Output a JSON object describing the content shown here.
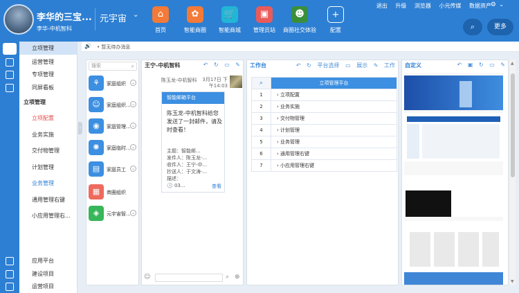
{
  "header": {
    "user_name": "李华的三宝...",
    "user_org": "李华-中机智科",
    "app_name": "元宇宙",
    "nav": [
      {
        "label": "首页",
        "icon": "home-icon",
        "color": "#f47a37"
      },
      {
        "label": "智能商圈",
        "icon": "flower-icon",
        "color": "#f47a37"
      },
      {
        "label": "智能商城",
        "icon": "cart-icon",
        "color": "#21b6d6"
      },
      {
        "label": "管理员站",
        "icon": "admin-icon",
        "color": "#e95b5b"
      },
      {
        "label": "商圈社交体验",
        "icon": "people-icon",
        "color": "#3a8f3a"
      },
      {
        "label": "配置",
        "icon": "plus-icon",
        "color": "#2d7fd3"
      }
    ],
    "top_links": [
      "退出",
      "升级",
      "浏览器",
      "小元传媒",
      "数据资产"
    ],
    "more_label": "更多"
  },
  "sidebar": {
    "top_items": [
      "立项管理",
      "运营管理",
      "专项管理",
      "同屏看板"
    ],
    "section_title": "立项管理",
    "sub_items": [
      "立项配置",
      "业务实施",
      "交付物管理",
      "计划管理",
      "业务管理",
      "通用管理右键",
      "小应用管理右..."
    ],
    "bottom_items": [
      "应用平台",
      "建设项目",
      "运营项目"
    ]
  },
  "notice": {
    "text": "• 暂无待办消息"
  },
  "contacts": {
    "search_placeholder": "搜索",
    "items": [
      {
        "name": "家庭组织",
        "icon": "group-icon",
        "color": "#3c8fe1"
      },
      {
        "name": "家庭组织...",
        "icon": "person-icon",
        "color": "#3c8fe1"
      },
      {
        "name": "家庭管理...",
        "icon": "camera-icon",
        "color": "#3c8fe1"
      },
      {
        "name": "家庭临时...",
        "icon": "gear-icon",
        "color": "#3c8fe1"
      },
      {
        "name": "家庭员工",
        "icon": "id-card-icon",
        "color": "#3c8fe1"
      },
      {
        "name": "商圈组织",
        "icon": "grid-icon",
        "color": "#ee6a5c"
      },
      {
        "name": "元宇宙智...",
        "icon": "layers-icon",
        "color": "#38b65a"
      }
    ]
  },
  "chat": {
    "title": "王宁-中机智科",
    "sender": "陈玉龙-中机智科",
    "date": "3月17日 下午14:03",
    "card_title": "智能邮箱平台",
    "card_message": "陈玉龙-中机智科给您发送了一封邮件，请及时查看！",
    "card_lines": [
      "主题：智能邮...",
      "发件人：陈玉龙-...",
      "收件人：王宁-中...",
      "抄送人：于文涛-...",
      "描述：",
      "🕓 03..."
    ],
    "card_link": "查看"
  },
  "workbench": {
    "title": "工作台",
    "tools": [
      "平台选择",
      "展示",
      "工作"
    ],
    "table_title": "立项管理平台",
    "rows": [
      {
        "num": "1",
        "label": "立项配置"
      },
      {
        "num": "2",
        "label": "业务实施"
      },
      {
        "num": "3",
        "label": "交付物管理"
      },
      {
        "num": "4",
        "label": "计划管理"
      },
      {
        "num": "5",
        "label": "业务管理"
      },
      {
        "num": "6",
        "label": "通用管理右键"
      },
      {
        "num": "7",
        "label": "小应用管理右键"
      }
    ]
  },
  "custom": {
    "title": "自定义"
  },
  "colors": {
    "primary": "#2d7fd3",
    "danger": "#e34c4c",
    "accent_orange": "#f47a37"
  }
}
